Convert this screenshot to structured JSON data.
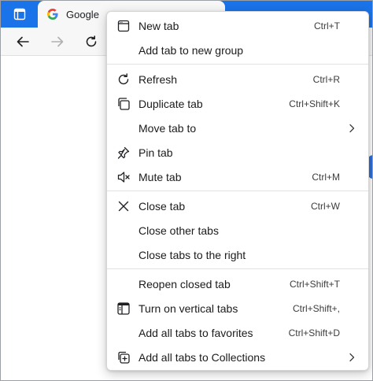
{
  "browser": {
    "active_tab_title": "Google",
    "accent_color": "#1a73e8"
  },
  "menu": {
    "groups": [
      {
        "items": [
          {
            "label": "New tab",
            "shortcut": "Ctrl+T",
            "icon": "new-tab-icon"
          },
          {
            "label": "Add tab to new group",
            "shortcut": "",
            "icon": ""
          }
        ]
      },
      {
        "items": [
          {
            "label": "Refresh",
            "shortcut": "Ctrl+R",
            "icon": "refresh-icon"
          },
          {
            "label": "Duplicate tab",
            "shortcut": "Ctrl+Shift+K",
            "icon": "duplicate-icon"
          },
          {
            "label": "Move tab to",
            "shortcut": "",
            "icon": "",
            "submenu": true
          },
          {
            "label": "Pin tab",
            "shortcut": "",
            "icon": "pin-icon"
          },
          {
            "label": "Mute tab",
            "shortcut": "Ctrl+M",
            "icon": "mute-icon"
          }
        ]
      },
      {
        "items": [
          {
            "label": "Close tab",
            "shortcut": "Ctrl+W",
            "icon": "close-icon"
          },
          {
            "label": "Close other tabs",
            "shortcut": "",
            "icon": ""
          },
          {
            "label": "Close tabs to the right",
            "shortcut": "",
            "icon": ""
          }
        ]
      },
      {
        "items": [
          {
            "label": "Reopen closed tab",
            "shortcut": "Ctrl+Shift+T",
            "icon": ""
          },
          {
            "label": "Turn on vertical tabs",
            "shortcut": "Ctrl+Shift+,",
            "icon": "vertical-tabs-icon"
          },
          {
            "label": "Add all tabs to favorites",
            "shortcut": "Ctrl+Shift+D",
            "icon": ""
          },
          {
            "label": "Add all tabs to Collections",
            "shortcut": "",
            "icon": "collections-icon",
            "submenu": true
          }
        ]
      }
    ]
  }
}
